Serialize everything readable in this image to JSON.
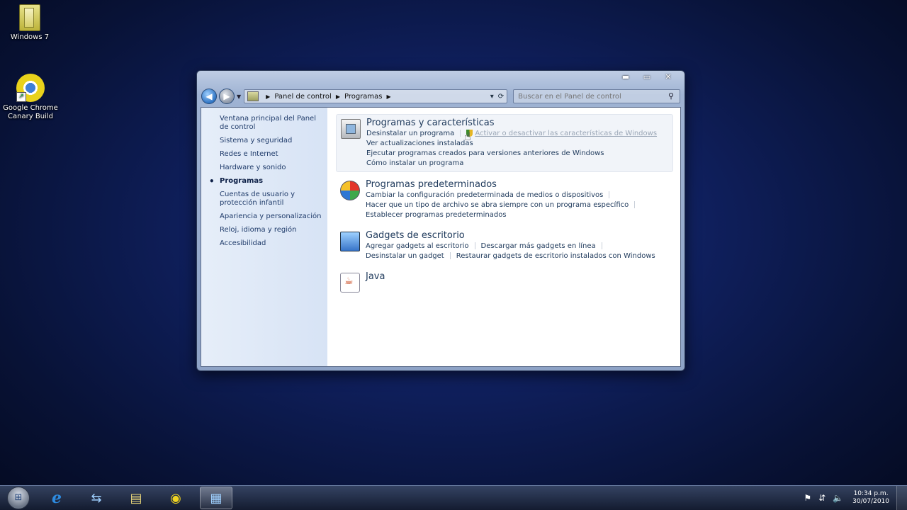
{
  "desktop": {
    "icons": [
      {
        "label": "Windows 7",
        "icon": "folder-icon"
      },
      {
        "label": "Google Chrome Canary Build",
        "icon": "chrome-canary-icon"
      }
    ]
  },
  "window": {
    "controls": {
      "minimize": "▬",
      "maximize": "▭",
      "close": "✕"
    },
    "breadcrumb": [
      "Panel de control",
      "Programas"
    ],
    "search_placeholder": "Buscar en el Panel de control",
    "sidebar": {
      "items": [
        {
          "label": "Ventana principal del Panel de control",
          "active": false
        },
        {
          "label": "Sistema y seguridad",
          "active": false
        },
        {
          "label": "Redes e Internet",
          "active": false
        },
        {
          "label": "Hardware y sonido",
          "active": false
        },
        {
          "label": "Programas",
          "active": true
        },
        {
          "label": "Cuentas de usuario y protección infantil",
          "active": false
        },
        {
          "label": "Apariencia y personalización",
          "active": false
        },
        {
          "label": "Reloj, idioma y región",
          "active": false
        },
        {
          "label": "Accesibilidad",
          "active": false
        }
      ]
    },
    "categories": [
      {
        "title": "Programas y características",
        "icon": "programs-features-icon",
        "rows": [
          [
            "Desinstalar un programa",
            "Activar o desactivar las características de Windows"
          ],
          [
            "Ver actualizaciones instaladas"
          ],
          [
            "Ejecutar programas creados para versiones anteriores de Windows"
          ],
          [
            "Cómo instalar un programa"
          ]
        ]
      },
      {
        "title": "Programas predeterminados",
        "icon": "default-programs-icon",
        "rows": [
          [
            "Cambiar la configuración predeterminada de medios o dispositivos"
          ],
          [
            "Hacer que un tipo de archivo se abra siempre con un programa específico"
          ],
          [
            "Establecer programas predeterminados"
          ]
        ]
      },
      {
        "title": "Gadgets de escritorio",
        "icon": "gadgets-icon",
        "rows": [
          [
            "Agregar gadgets al escritorio",
            "Descargar más gadgets en línea"
          ],
          [
            "Desinstalar un gadget",
            "Restaurar gadgets de escritorio instalados con Windows"
          ]
        ]
      },
      {
        "title": "Java",
        "icon": "java-icon",
        "rows": []
      }
    ]
  },
  "taskbar": {
    "apps": [
      "internet-explorer-icon",
      "network-icon",
      "file-explorer-icon",
      "chrome-canary-icon",
      "control-panel-icon"
    ],
    "clock": {
      "time": "10:34 p.m.",
      "date": "30/07/2010"
    }
  }
}
